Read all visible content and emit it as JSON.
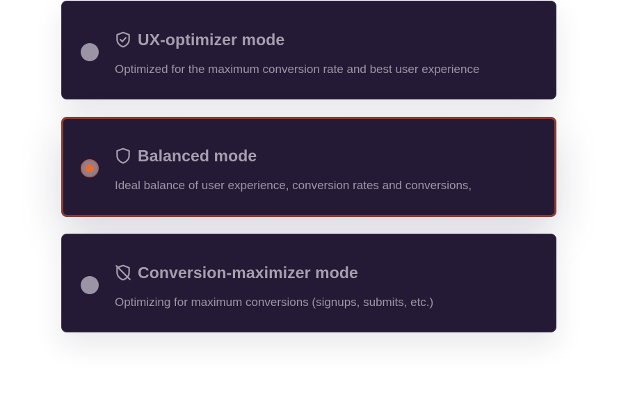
{
  "modes": [
    {
      "title": "UX-optimizer mode",
      "description": "Optimized for the maximum conversion rate and best user experience",
      "icon": "shield-check-icon",
      "selected": false
    },
    {
      "title": "Balanced mode",
      "description": "Ideal balance of user experience, conversion rates and conversions,",
      "icon": "shield-icon",
      "selected": true
    },
    {
      "title": "Conversion-maximizer mode",
      "description": "Optimizing for maximum conversions (signups, submits, etc.)",
      "icon": "shield-off-icon",
      "selected": false
    }
  ],
  "colors": {
    "card_background": "#251a35",
    "selected_border": "#8e3a2e",
    "radio_dot": "#f06a2c",
    "text": "#a59fae"
  }
}
